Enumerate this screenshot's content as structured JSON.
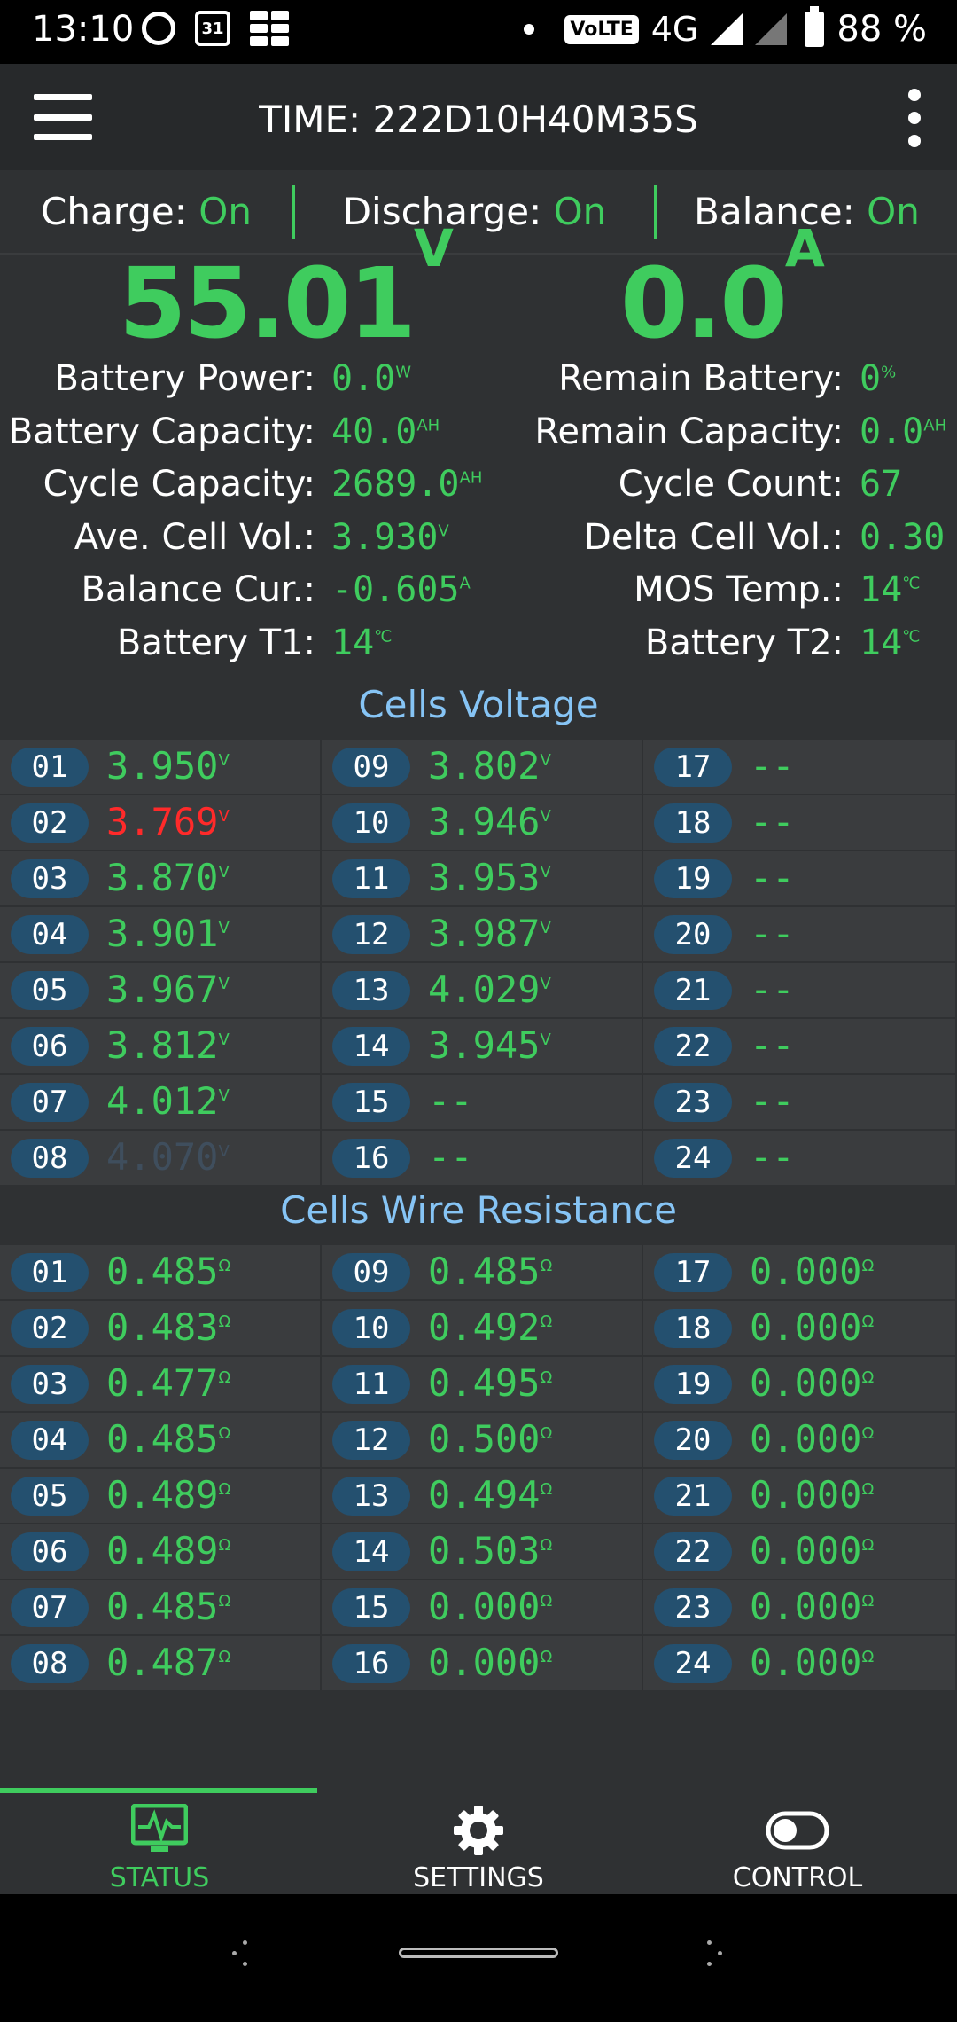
{
  "status_bar": {
    "time": "13:10",
    "calendar_day": "31",
    "volte": "VoLTE",
    "network": "4G",
    "battery": "88 %"
  },
  "app_bar": {
    "title": "TIME: 222D10H40M35S"
  },
  "switches": [
    {
      "label": "Charge:",
      "state": "On"
    },
    {
      "label": "Discharge:",
      "state": "On"
    },
    {
      "label": "Balance:",
      "state": "On"
    }
  ],
  "totals": {
    "voltage": "55.01",
    "voltage_unit": "V",
    "current": "0.0",
    "current_unit": "A"
  },
  "info_left": [
    {
      "label": "Battery Power:",
      "value": "0.0",
      "unit": "W"
    },
    {
      "label": "Battery Capacity:",
      "value": "40.0",
      "unit": "AH"
    },
    {
      "label": "Cycle Capacity:",
      "value": "2689.0",
      "unit": "AH"
    },
    {
      "label": "Ave. Cell Vol.:",
      "value": "3.930",
      "unit": "V"
    },
    {
      "label": "Balance Cur.:",
      "value": "-0.605",
      "unit": "A"
    },
    {
      "label": "Battery T1:",
      "value": "14",
      "unit": "℃"
    }
  ],
  "info_right": [
    {
      "label": "Remain Battery:",
      "value": "0",
      "unit": "%"
    },
    {
      "label": "Remain Capacity:",
      "value": "0.0",
      "unit": "AH"
    },
    {
      "label": "Cycle Count:",
      "value": "67",
      "unit": ""
    },
    {
      "label": "Delta Cell Vol.:",
      "value": "0.30",
      "unit": ""
    },
    {
      "label": "MOS Temp.:",
      "value": "14",
      "unit": "℃"
    },
    {
      "label": "Battery T2:",
      "value": "14",
      "unit": "℃"
    }
  ],
  "cells_voltage_title": "Cells Voltage",
  "cells_voltage": [
    {
      "num": "01",
      "value": "3.950",
      "unit": "V"
    },
    {
      "num": "02",
      "value": "3.769",
      "unit": "V",
      "status": "low"
    },
    {
      "num": "03",
      "value": "3.870",
      "unit": "V"
    },
    {
      "num": "04",
      "value": "3.901",
      "unit": "V"
    },
    {
      "num": "05",
      "value": "3.967",
      "unit": "V"
    },
    {
      "num": "06",
      "value": "3.812",
      "unit": "V"
    },
    {
      "num": "07",
      "value": "4.012",
      "unit": "V"
    },
    {
      "num": "08",
      "value": "4.070",
      "unit": "V",
      "status": "high"
    },
    {
      "num": "09",
      "value": "3.802",
      "unit": "V"
    },
    {
      "num": "10",
      "value": "3.946",
      "unit": "V"
    },
    {
      "num": "11",
      "value": "3.953",
      "unit": "V"
    },
    {
      "num": "12",
      "value": "3.987",
      "unit": "V"
    },
    {
      "num": "13",
      "value": "4.029",
      "unit": "V"
    },
    {
      "num": "14",
      "value": "3.945",
      "unit": "V"
    },
    {
      "num": "15",
      "value": "--",
      "unit": ""
    },
    {
      "num": "16",
      "value": "--",
      "unit": ""
    },
    {
      "num": "17",
      "value": "--",
      "unit": ""
    },
    {
      "num": "18",
      "value": "--",
      "unit": ""
    },
    {
      "num": "19",
      "value": "--",
      "unit": ""
    },
    {
      "num": "20",
      "value": "--",
      "unit": ""
    },
    {
      "num": "21",
      "value": "--",
      "unit": ""
    },
    {
      "num": "22",
      "value": "--",
      "unit": ""
    },
    {
      "num": "23",
      "value": "--",
      "unit": ""
    },
    {
      "num": "24",
      "value": "--",
      "unit": ""
    }
  ],
  "wire_resistance_title": "Cells Wire Resistance",
  "wire_resistance": [
    {
      "num": "01",
      "value": "0.485",
      "unit": "Ω"
    },
    {
      "num": "02",
      "value": "0.483",
      "unit": "Ω"
    },
    {
      "num": "03",
      "value": "0.477",
      "unit": "Ω"
    },
    {
      "num": "04",
      "value": "0.485",
      "unit": "Ω"
    },
    {
      "num": "05",
      "value": "0.489",
      "unit": "Ω"
    },
    {
      "num": "06",
      "value": "0.489",
      "unit": "Ω"
    },
    {
      "num": "07",
      "value": "0.485",
      "unit": "Ω"
    },
    {
      "num": "08",
      "value": "0.487",
      "unit": "Ω"
    },
    {
      "num": "09",
      "value": "0.485",
      "unit": "Ω"
    },
    {
      "num": "10",
      "value": "0.492",
      "unit": "Ω"
    },
    {
      "num": "11",
      "value": "0.495",
      "unit": "Ω"
    },
    {
      "num": "12",
      "value": "0.500",
      "unit": "Ω"
    },
    {
      "num": "13",
      "value": "0.494",
      "unit": "Ω"
    },
    {
      "num": "14",
      "value": "0.503",
      "unit": "Ω"
    },
    {
      "num": "15",
      "value": "0.000",
      "unit": "Ω"
    },
    {
      "num": "16",
      "value": "0.000",
      "unit": "Ω"
    },
    {
      "num": "17",
      "value": "0.000",
      "unit": "Ω"
    },
    {
      "num": "18",
      "value": "0.000",
      "unit": "Ω"
    },
    {
      "num": "19",
      "value": "0.000",
      "unit": "Ω"
    },
    {
      "num": "20",
      "value": "0.000",
      "unit": "Ω"
    },
    {
      "num": "21",
      "value": "0.000",
      "unit": "Ω"
    },
    {
      "num": "22",
      "value": "0.000",
      "unit": "Ω"
    },
    {
      "num": "23",
      "value": "0.000",
      "unit": "Ω"
    },
    {
      "num": "24",
      "value": "0.000",
      "unit": "Ω"
    }
  ],
  "bottom_nav": [
    {
      "label": "STATUS",
      "icon": "monitor-pulse-icon",
      "active": true
    },
    {
      "label": "SETTINGS",
      "icon": "gear-icon",
      "active": false
    },
    {
      "label": "CONTROL",
      "icon": "toggle-icon",
      "active": false
    }
  ],
  "colors": {
    "accent_green": "#3fcc5e",
    "low_red": "#ff2a2a",
    "title_blue": "#86c4f5",
    "badge_blue": "#24506f"
  }
}
